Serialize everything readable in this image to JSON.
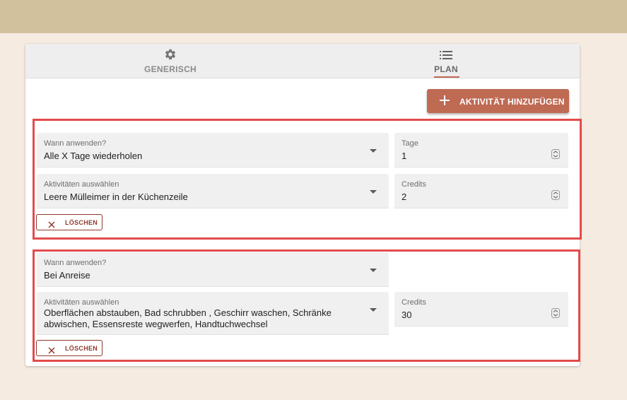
{
  "tabs": [
    {
      "label": "GENERISCH",
      "icon": "gear-icon"
    },
    {
      "label": "PLAN",
      "icon": "list-icon"
    }
  ],
  "active_tab": "PLAN",
  "add_button": {
    "label": "AKTIVITÄT HINZUFÜGEN",
    "icon": "plus-icon"
  },
  "rules": [
    {
      "when_label": "Wann anwenden?",
      "when_value": "Alle X Tage wiederholen",
      "days_label": "Tage",
      "days_value": "1",
      "activities_label": "Aktivitäten auswählen",
      "activities_value": "Leere Mülleimer in der Küchenzeile",
      "credits_label": "Credits",
      "credits_value": "2",
      "delete_label": "LÖSCHEN"
    },
    {
      "when_label": "Wann anwenden?",
      "when_value": "Bei Anreise",
      "activities_label": "Aktivitäten auswählen",
      "activities_line1": "Oberflächen abstauben, Bad schrubben , Geschirr waschen, Schränke",
      "activities_line2": "abwischen, Essensreste wegwerfen, Handtuchwechsel",
      "credits_label": "Credits",
      "credits_value": "30",
      "delete_label": "LÖSCHEN"
    }
  ],
  "colors": {
    "page_bg": "#f5ebe1",
    "topbar": "#d2c19d",
    "accent": "#bf6a53",
    "highlight_border": "#e34b4b",
    "delete_border": "#8f3a2b"
  }
}
